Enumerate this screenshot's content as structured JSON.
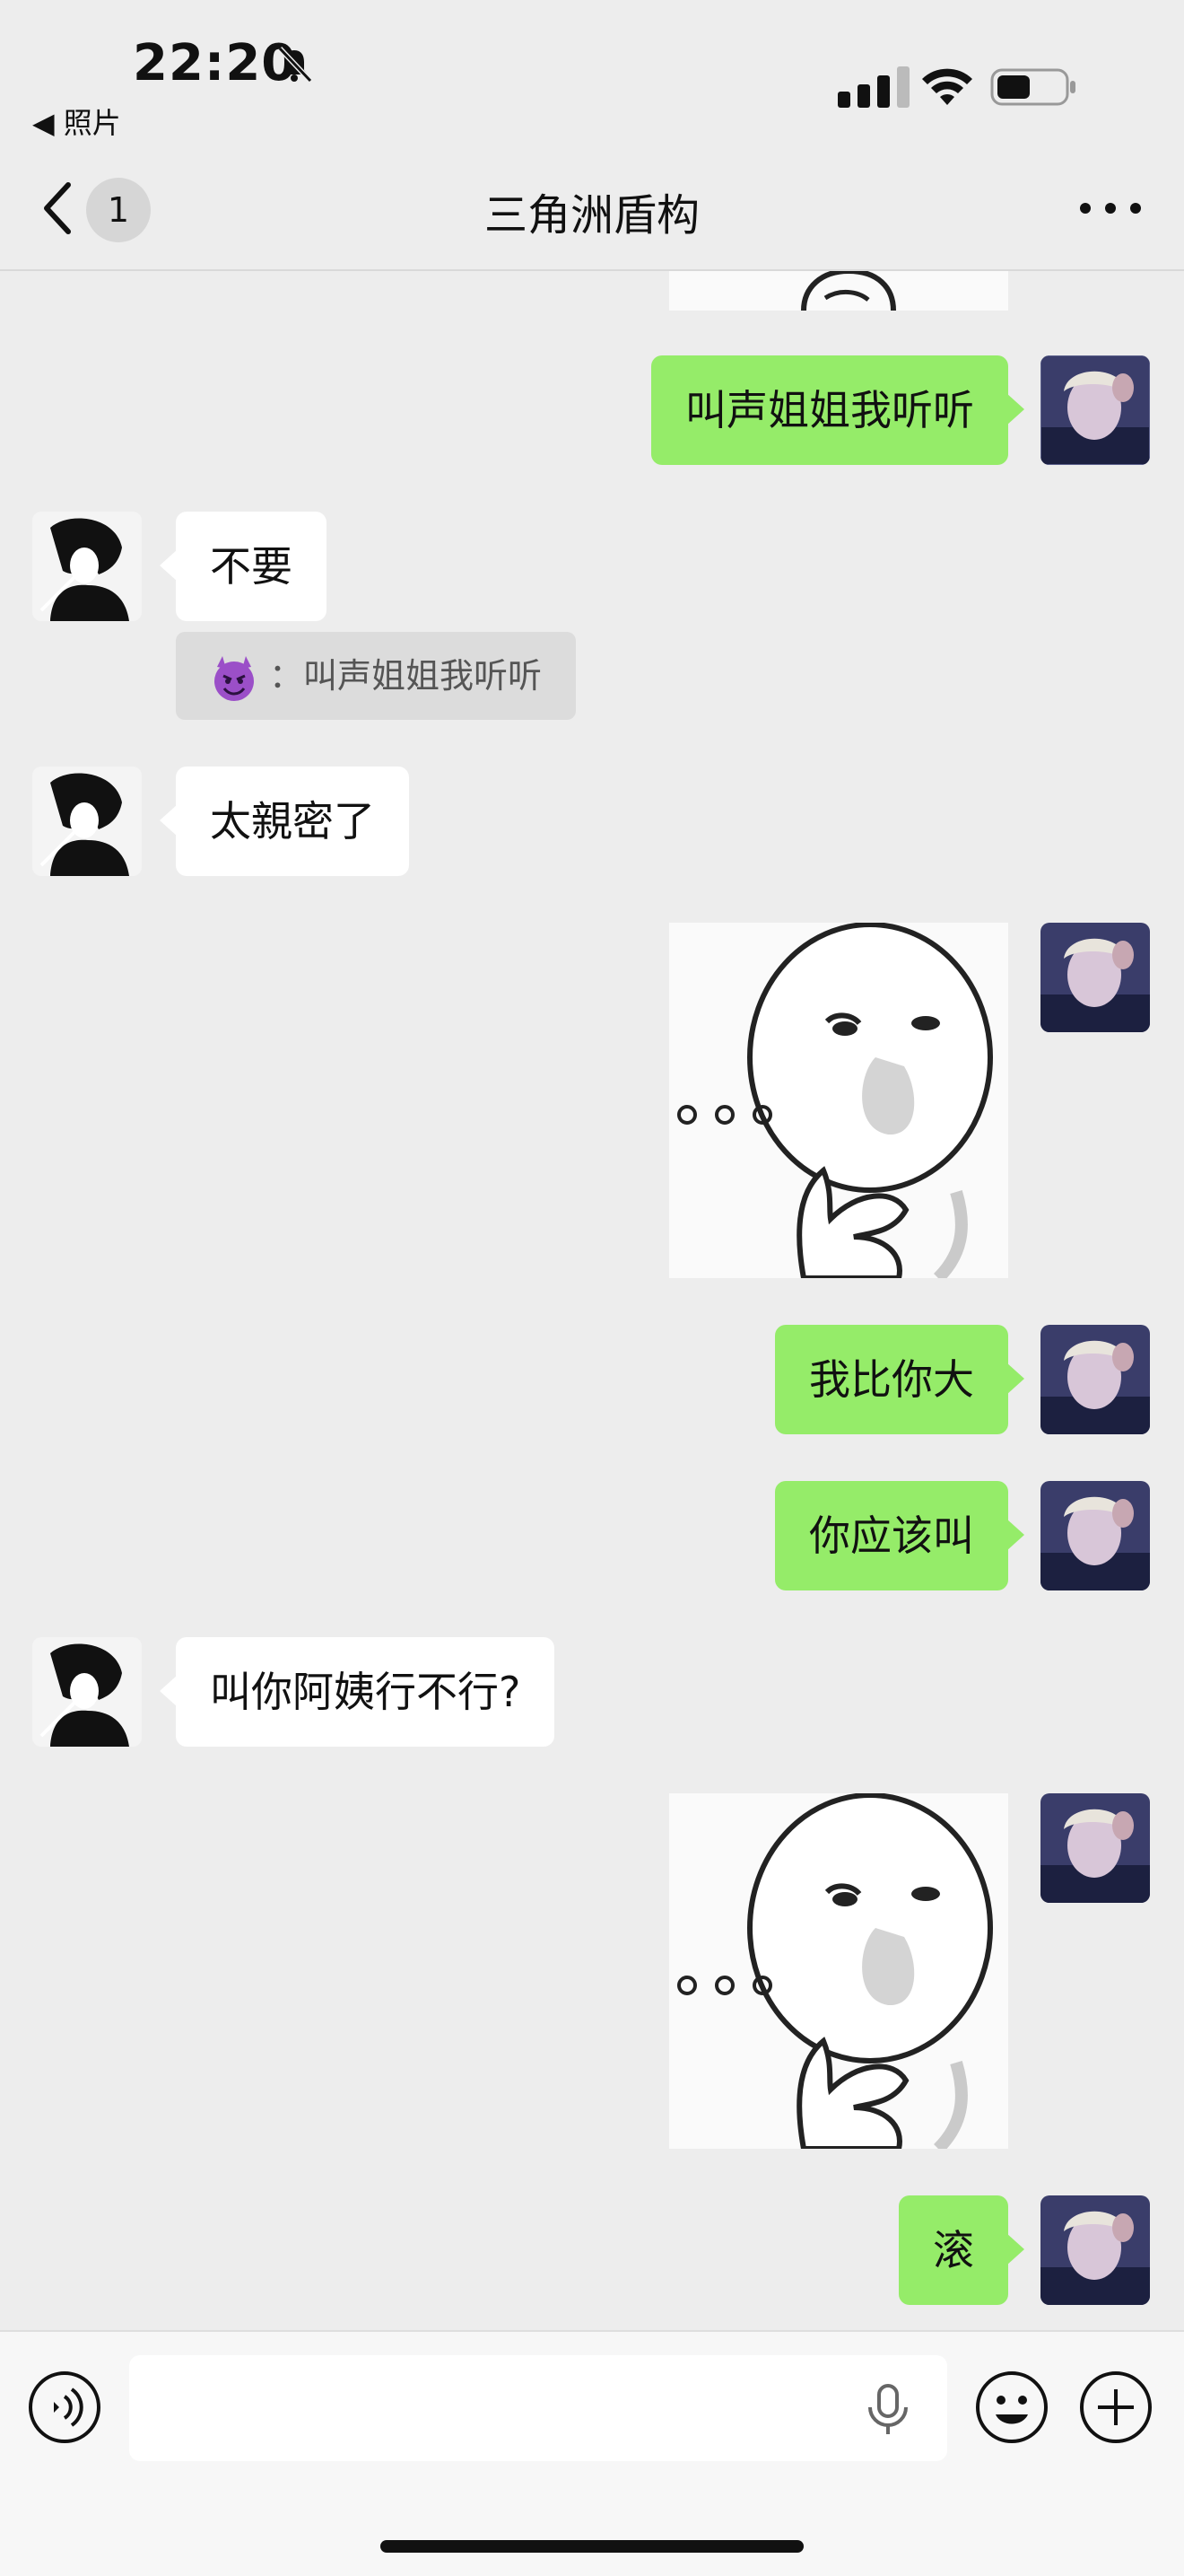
{
  "status_bar": {
    "time": "22:20",
    "back_app": "◀ 照片"
  },
  "nav": {
    "unread": "1",
    "title": "三角洲盾构"
  },
  "messages": [
    {
      "from": "me",
      "text": "叫声姐姐我听听"
    },
    {
      "from": "them",
      "text": "不要",
      "quote": {
        "emoji": "purple-devil-emoji",
        "text": "叫声姐姐我听听"
      }
    },
    {
      "from": "them",
      "text": "太親密了"
    },
    {
      "from": "me",
      "sticker": "thinking-meme-sticker"
    },
    {
      "from": "me",
      "text": "我比你大"
    },
    {
      "from": "me",
      "text": "你应该叫"
    },
    {
      "from": "them",
      "text": "叫你阿姨行不行?"
    },
    {
      "from": "me",
      "sticker": "thinking-meme-sticker"
    },
    {
      "from": "me",
      "text": "滚"
    }
  ],
  "quote_separator": "：",
  "input": {
    "value": "",
    "placeholder": ""
  },
  "colors": {
    "my_bubble": "#95ec69",
    "their_bubble": "#ffffff",
    "background": "#ededed"
  }
}
